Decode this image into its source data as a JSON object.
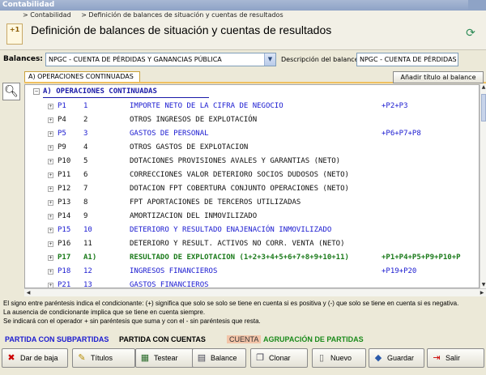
{
  "window": {
    "title": "Contabilidad"
  },
  "breadcrumb": {
    "item1": "> Contabilidad",
    "item2": "> Definición de balances de situación y cuentas de resultados"
  },
  "header": {
    "title": "Definición de balances de situación y cuentas de resultados",
    "logo_text": "+1"
  },
  "filters": {
    "balances_label": "Balances:",
    "balances_value": "NPGC - CUENTA DE PÉRDIDAS Y GANANCIAS PÚBLICA",
    "description_label": "Descripción del balance:",
    "description_value": "NPGC - CUENTA DE PÉRDIDAS Y"
  },
  "tab": {
    "label": "A) OPERACIONES CONTINUADAS"
  },
  "add_title_button": "Añadir título al balance",
  "tree": {
    "root": "A) OPERACIONES CONTINUADAS",
    "rows": [
      {
        "code": "P1",
        "num": "1",
        "desc": "IMPORTE NETO DE LA CIFRA DE NEGOCIO",
        "formula": "+P2+P3",
        "style": "t-blue"
      },
      {
        "code": "P4",
        "num": "2",
        "desc": "OTROS INGRESOS DE EXPLOTACIÓN",
        "formula": "",
        "style": "t-black"
      },
      {
        "code": "P5",
        "num": "3",
        "desc": "GASTOS DE PERSONAL",
        "formula": "+P6+P7+P8",
        "style": "t-blue"
      },
      {
        "code": "P9",
        "num": "4",
        "desc": "OTROS GASTOS DE EXPLOTACION",
        "formula": "",
        "style": "t-black"
      },
      {
        "code": "P10",
        "num": "5",
        "desc": "DOTACIONES PROVISIONES AVALES Y GARANTIAS (NETO)",
        "formula": "",
        "style": "t-black"
      },
      {
        "code": "P11",
        "num": "6",
        "desc": "CORRECCIONES VALOR DETERIORO SOCIOS DUDOSOS (NETO)",
        "formula": "",
        "style": "t-black"
      },
      {
        "code": "P12",
        "num": "7",
        "desc": "DOTACION FPT COBERTURA CONJUNTO OPERACIONES (NETO)",
        "formula": "",
        "style": "t-black"
      },
      {
        "code": "P13",
        "num": "8",
        "desc": "FPT APORTACIONES DE TERCEROS UTILIZADAS",
        "formula": "",
        "style": "t-black"
      },
      {
        "code": "P14",
        "num": "9",
        "desc": "AMORTIZACION DEL INMOVILIZADO",
        "formula": "",
        "style": "t-black"
      },
      {
        "code": "P15",
        "num": "10",
        "desc": "DETERIORO Y RESULTADO ENAJENACIÓN INMOVILIZADO",
        "formula": "",
        "style": "t-blue"
      },
      {
        "code": "P16",
        "num": "11",
        "desc": "DETERIORO Y  RESULT. ACTIVOS NO CORR. VENTA (NETO)",
        "formula": "",
        "style": "t-black"
      },
      {
        "code": "P17",
        "num": "A1)",
        "desc": "RESULTADO DE EXPLOTACION (1+2+3+4+5+6+7+8+9+10+11)",
        "formula": "+P1+P4+P5+P9+P10+P",
        "style": "t-green"
      },
      {
        "code": "P18",
        "num": "12",
        "desc": "INGRESOS FINANCIEROS",
        "formula": "+P19+P20",
        "style": "t-blue"
      },
      {
        "code": "P21",
        "num": "13",
        "desc": "GASTOS FINANCIEROS",
        "formula": "",
        "style": "t-blue"
      }
    ]
  },
  "notes": {
    "line1": "El signo entre paréntesis indica el condicionante: (+) significa que solo se solo se tiene en cuenta si es positiva y (-) que solo se tiene en cuenta si es negativa.",
    "line2": "La ausencia de condicionante implica que se tiene en cuenta siempre.",
    "line3": "Se indicará con el operador + sin paréntesis que suma y con el - sin paréntesis que resta."
  },
  "legend": {
    "subcuentas": "PARTIDA CON SUBPARTIDAS",
    "cuentas": "PARTIDA CON CUENTAS",
    "cuenta": "CUENTA",
    "agrupacion": "AGRUPACIÓN DE PARTIDAS"
  },
  "buttons": {
    "dar_baja": "Dar de baja",
    "titulos": "Títulos",
    "testear": "Testear",
    "balance": "Balance",
    "clonar": "Clonar",
    "nuevo": "Nuevo",
    "guardar": "Guardar",
    "salir": "Salir"
  }
}
